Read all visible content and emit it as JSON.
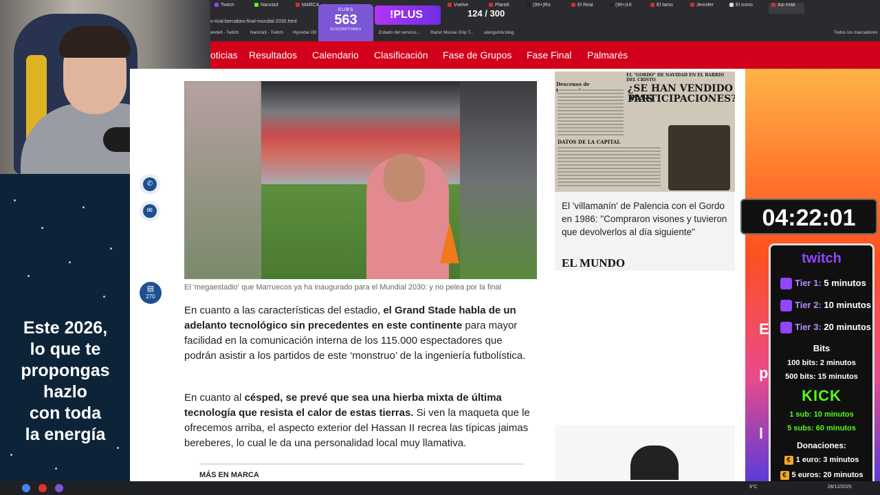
{
  "browser": {
    "tabs": [
      "Twitch",
      "Nancla3",
      "MARCA",
      "Vuelve",
      "Plantill",
      "(99+)Ro",
      "El Real",
      "(99+)Ut",
      "El famo",
      "Jennifer",
      "El icono",
      "Así está"
    ],
    "url": "s-rival-bernabeu-final-mundial-2030.html",
    "bookmarks": [
      "andell - Twitch",
      "Nancla3 - Twitch",
      "Hyundai i30",
      "Estado del servicio...",
      "Razer Mouse Grip T...",
      "alangulotv.blog",
      "Todos los marcadores"
    ]
  },
  "overlay": {
    "subs_title": "SUBS",
    "subs_count": "563",
    "subs_sub": "SUSCRIPTORES",
    "plus": "!PLUS",
    "goal": "124 / 300",
    "timer": "04:22:01",
    "promo": [
      "Este 2026,",
      "lo que te",
      "propongas",
      "hazlo",
      "con toda",
      "la energía"
    ],
    "right_promo": [
      "Es",
      "p",
      "l"
    ]
  },
  "nav": {
    "items": [
      "oticias",
      "Resultados",
      "Calendario",
      "Clasificación",
      "Fase de Grupos",
      "Fase Final",
      "Palmarés"
    ]
  },
  "article": {
    "caption": "El 'megaestadio' que Marruecos ya ha inaugurado para el Mundial 2030: y no pelea por la final",
    "p1_a": "En cuanto a las características del estadio, ",
    "p1_b": "el Grand Stade habla de un adelanto tecnológico sin precedentes en este continente",
    "p1_c": " para mayor facilidad en la comunicación interna de los 115.000 espectadores que podrán asistir a los partidos de este ‘monstruo’ de la ingeniería futbolística.",
    "p2_a": "En cuanto al ",
    "p2_b": "césped, se prevé que sea una hierba mixta de última tecnología que resista el calor de estas tierras.",
    "p2_c": " Si ven la maqueta que le ofrecemos arriba, el aspecto exterior del Hassan II recrea las típicas jaimas bereberes, lo cual le da una personalidad local muy llamativa.",
    "mas": "MÁS EN MARCA",
    "comments": "270"
  },
  "sidebar": {
    "newspaper_head1": "¿SE HAN VENDIDO MAS",
    "newspaper_head2": "PARTICIPACIONES?",
    "newspaper_small": "EL \"GORDO\" DE NAVIDAD EN EL BARRIO DEL CRISTO",
    "newspaper_left": "Descenso de temperaturas",
    "newspaper_data": "DATOS DE LA CAPITAL",
    "title": "El 'villamanín' de Palencia con el Gordo en 1986: \"Compraron visones y tuvieron que devolverlos al día siguiente\"",
    "source": "EL MUNDO"
  },
  "twitch_panel": {
    "logo": "twitch",
    "tiers": [
      {
        "label": "Tier 1:",
        "value": "5 minutos"
      },
      {
        "label": "Tier 2:",
        "value": "10 minutos"
      },
      {
        "label": "Tier 3:",
        "value": "20 minutos"
      }
    ],
    "bits_title": "Bits",
    "bits": [
      "100 bits: 2 minutos",
      "500 bits: 15 minutos"
    ],
    "kick_logo": "KICK",
    "kick": [
      "1 sub: 10 minutos",
      "5 subs: 60 minutos"
    ],
    "donations_title": "Donaciones:",
    "donations": [
      "1 euro: 3 minutos",
      "5 euros: 20 minutos"
    ]
  },
  "taskbar": {
    "weather": "9°C",
    "date": "28/12/2025"
  }
}
